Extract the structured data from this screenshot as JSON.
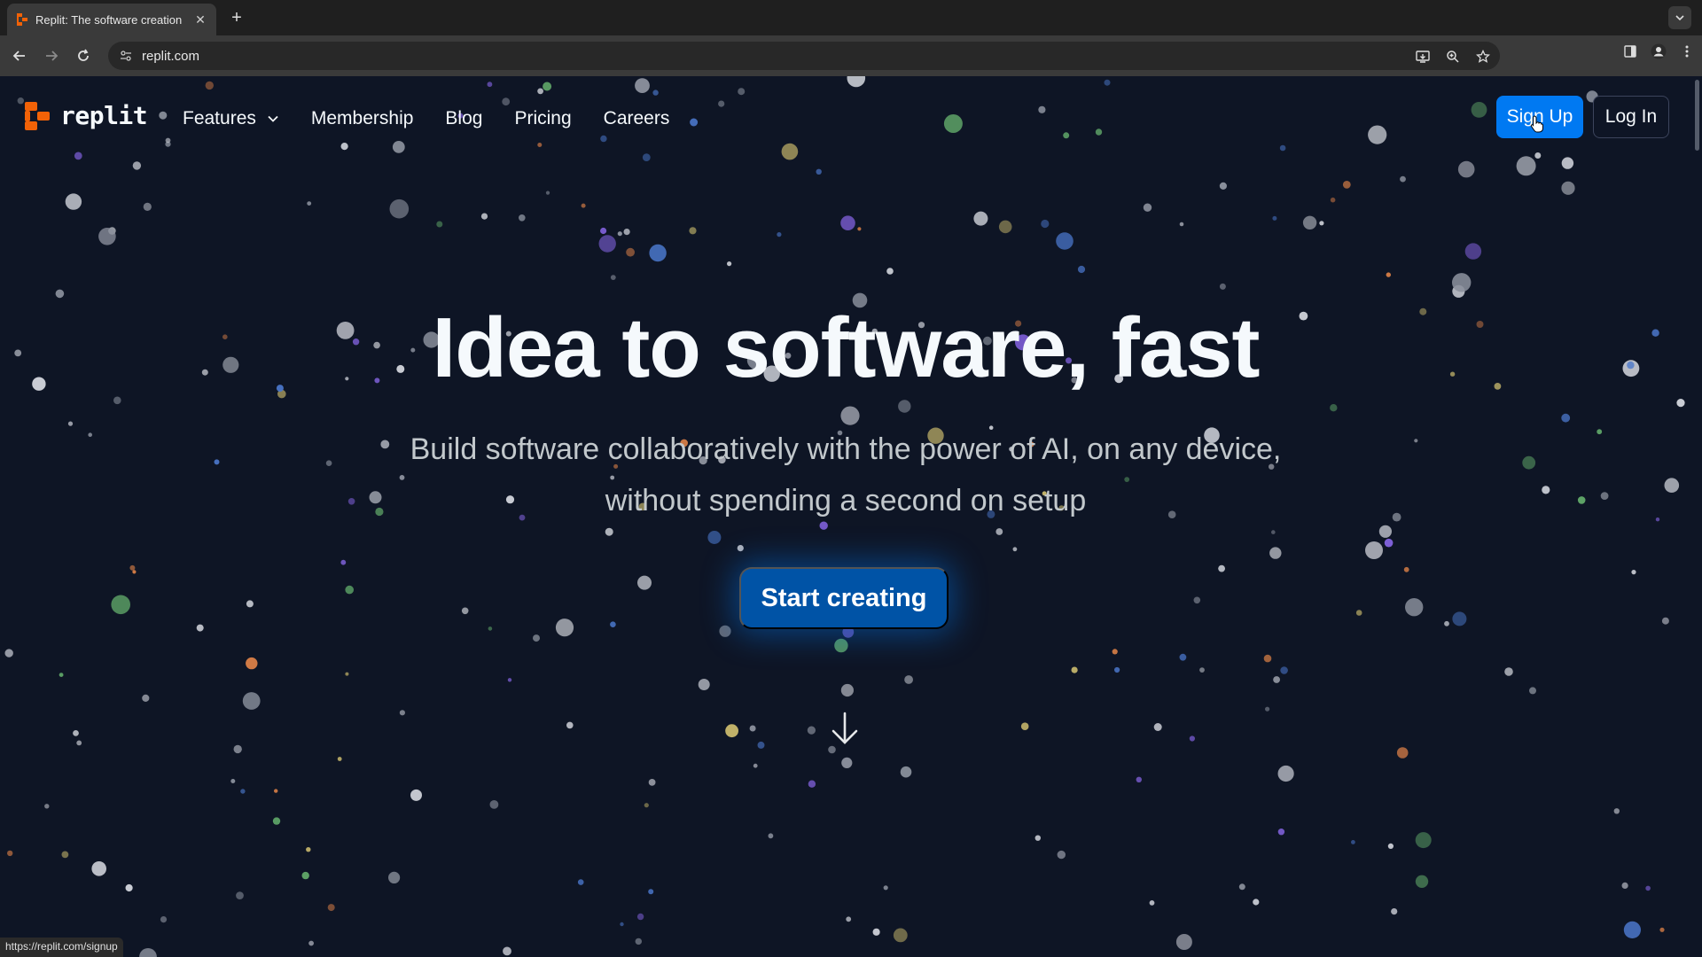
{
  "browser": {
    "tab_title": "Replit: The software creation",
    "tab_close_glyph": "✕",
    "new_tab_glyph": "+",
    "url": "replit.com",
    "status_url": "https://replit.com/signup"
  },
  "nav": {
    "logo_text": "replit",
    "links": [
      "Features",
      "Membership",
      "Blog",
      "Pricing",
      "Careers"
    ],
    "signup_label": "Sign Up",
    "login_label": "Log In"
  },
  "hero": {
    "title": "Idea to software, fast",
    "subtitle": "Build software collaboratively with the power of AI, on any device, without spending a second on setup",
    "cta_label": "Start creating"
  },
  "colors": {
    "page_bg": "#0e1525",
    "brand_orange": "#f26207",
    "signup_blue": "#0079f2",
    "cta_blue": "#0053a6"
  }
}
